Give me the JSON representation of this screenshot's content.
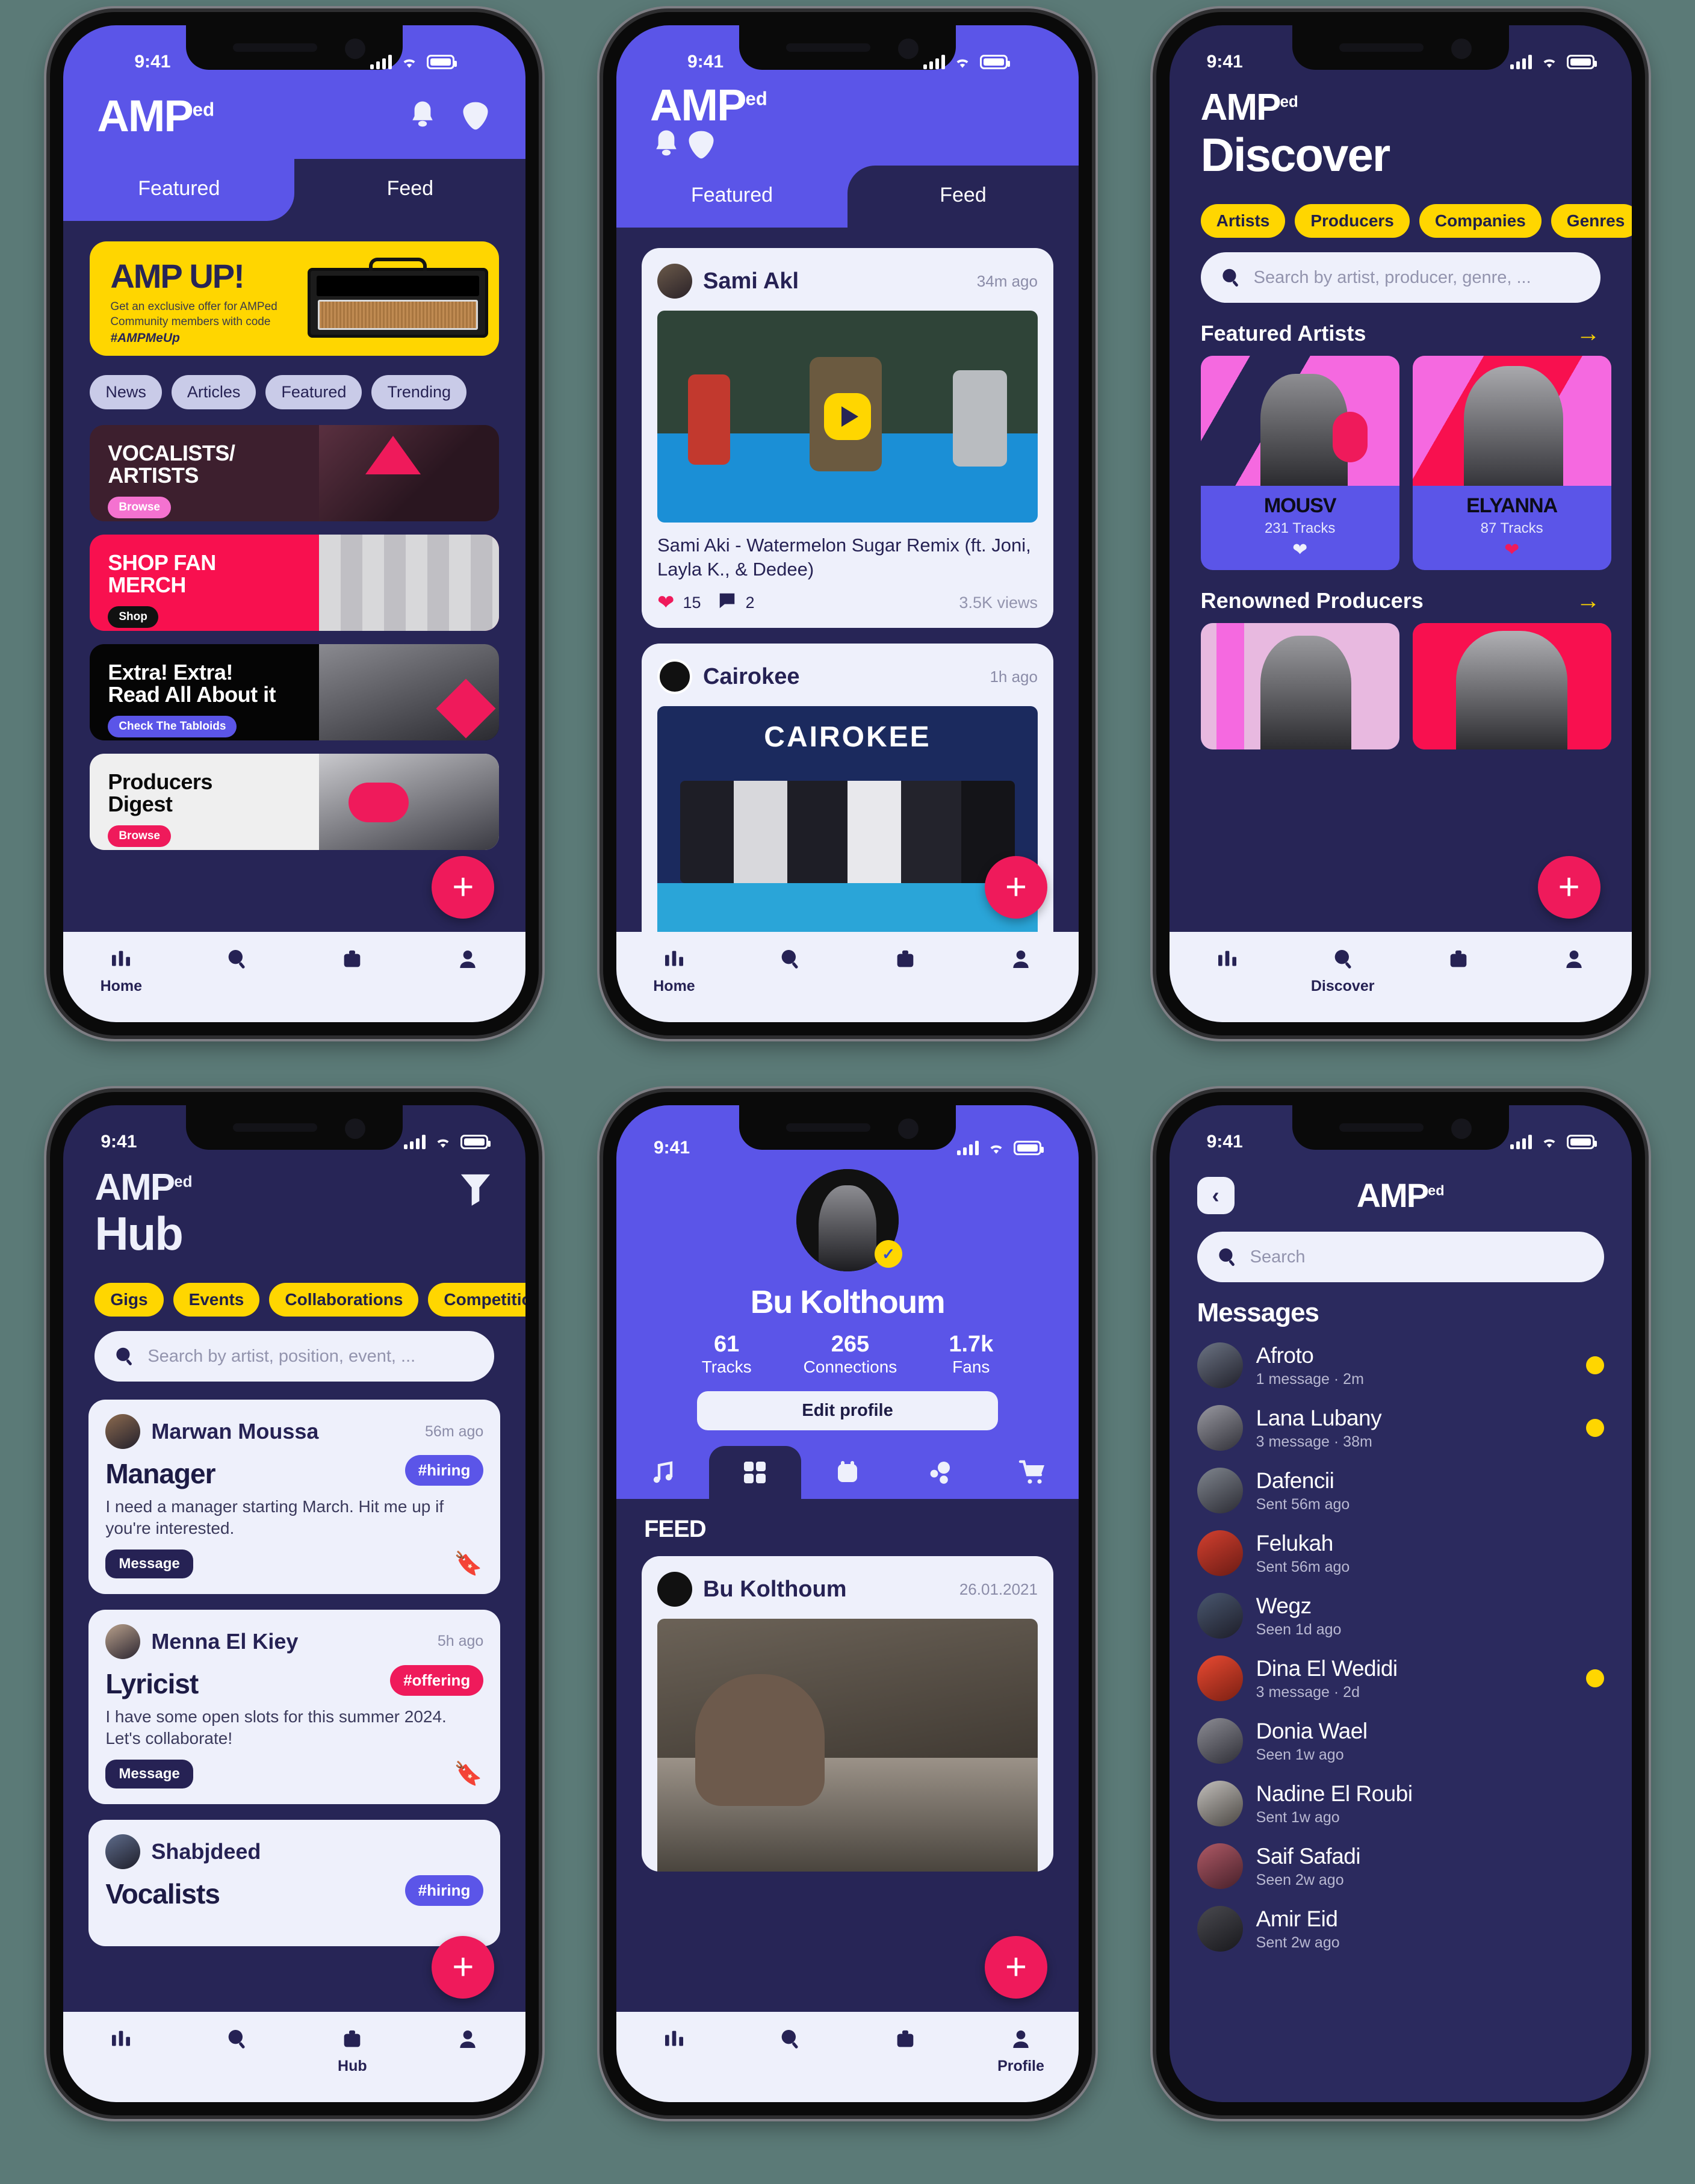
{
  "brand": {
    "name": "AMP",
    "sup": "ed",
    "accent_purple": "#5b55e8",
    "accent_yellow": "#ffd600",
    "accent_pink": "#ef1a5b",
    "dark": "#272556"
  },
  "status_bar": {
    "time": "9:41"
  },
  "screens": {
    "home": {
      "tabs": [
        {
          "label": "Featured",
          "active": true
        },
        {
          "label": "Feed",
          "active": false
        }
      ],
      "promo_banner": {
        "title": "AMP UP!",
        "body": "Get an exclusive offer for AMPed Community members with code",
        "hashtag": "#AMPMeUp"
      },
      "chips": [
        "News",
        "Articles",
        "Featured",
        "Trending"
      ],
      "cards": [
        {
          "title": "VOCALISTS/\nARTISTS",
          "button": "Browse",
          "bg": "#3d1f2e",
          "text": "#ffffff",
          "btn_bg": "#f472d0",
          "btn_text": "#ffffff"
        },
        {
          "title": "SHOP FAN\nMERCH",
          "button": "Shop",
          "bg": "#f8104f",
          "text": "#ffffff",
          "btn_bg": "#111111",
          "btn_text": "#ffffff"
        },
        {
          "title": "Extra! Extra!\nRead All About it",
          "button": "Check The Tabloids",
          "bg": "#050505",
          "text": "#ffffff",
          "btn_bg": "#5b55e8",
          "btn_text": "#ffffff"
        },
        {
          "title": "Producers\nDigest",
          "button": "Browse",
          "bg": "#efefef",
          "text": "#0a0a0a",
          "btn_bg": "#ef1a5b",
          "btn_text": "#ffffff"
        }
      ],
      "nav": [
        {
          "icon": "equalizer-icon",
          "label": "Home",
          "active": true
        },
        {
          "icon": "search-icon",
          "label": "",
          "active": false
        },
        {
          "icon": "briefcase-icon",
          "label": "",
          "active": false
        },
        {
          "icon": "person-icon",
          "label": "",
          "active": false
        }
      ]
    },
    "feed": {
      "tabs": [
        {
          "label": "Featured",
          "active": false
        },
        {
          "label": "Feed",
          "active": true
        }
      ],
      "posts": [
        {
          "author": "Sami Akl",
          "time": "34m ago",
          "title": "Sami Aki - Watermelon Sugar Remix (ft. Joni, Layla K., & Dedee)",
          "likes": "15",
          "comments": "2",
          "views": "3.5K views",
          "has_play": true
        },
        {
          "author": "Cairokee",
          "time": "1h ago",
          "title": "",
          "likes": "",
          "comments": "",
          "views": "",
          "media_label": "CAIROKEE"
        }
      ],
      "nav": [
        {
          "icon": "equalizer-icon",
          "label": "Home",
          "active": true
        },
        {
          "icon": "search-icon",
          "label": "",
          "active": false
        },
        {
          "icon": "briefcase-icon",
          "label": "",
          "active": false
        },
        {
          "icon": "person-icon",
          "label": "",
          "active": false
        }
      ]
    },
    "discover": {
      "title": "Discover",
      "chips": [
        "Artists",
        "Producers",
        "Companies",
        "Genres"
      ],
      "search_placeholder": "Search by artist, producer, genre, ...",
      "sections": [
        {
          "heading": "Featured Artists",
          "items": [
            {
              "name": "MOUSV",
              "tracks": "231 Tracks",
              "liked": false,
              "bg": "#f569e0"
            },
            {
              "name": "ELYANNA",
              "tracks": "87 Tracks",
              "liked": true,
              "bg": "#f8104f"
            }
          ]
        },
        {
          "heading": "Renowned Producers",
          "items": [
            {
              "name": "",
              "tracks": "",
              "liked": false,
              "bg": "#e8b9e0"
            },
            {
              "name": "",
              "tracks": "",
              "liked": false,
              "bg": "#f8104f"
            }
          ]
        }
      ],
      "nav": [
        {
          "icon": "equalizer-icon",
          "label": "",
          "active": false
        },
        {
          "icon": "search-icon",
          "label": "Discover",
          "active": true
        },
        {
          "icon": "briefcase-icon",
          "label": "",
          "active": false
        },
        {
          "icon": "person-icon",
          "label": "",
          "active": false
        }
      ]
    },
    "hub": {
      "title": "Hub",
      "chips": [
        "Gigs",
        "Events",
        "Collaborations",
        "Competitions"
      ],
      "search_placeholder": "Search by artist, position, event, ...",
      "listings": [
        {
          "author": "Marwan Moussa",
          "time": "56m ago",
          "role": "Manager",
          "tag": "#hiring",
          "tag_color": "#5b55e8",
          "text": "I need a manager starting March. Hit me up if you're interested.",
          "button": "Message",
          "bookmark_color": "#262254"
        },
        {
          "author": "Menna El Kiey",
          "time": "5h ago",
          "role": "Lyricist",
          "tag": "#offering",
          "tag_color": "#ef1a5b",
          "text": "I have some open slots for this summer 2024. Let's collaborate!",
          "button": "Message",
          "bookmark_color": "#ef1a5b"
        },
        {
          "author": "Shabjdeed",
          "time": "",
          "role": "Vocalists",
          "tag": "#hiring",
          "tag_color": "#5b55e8",
          "text": "",
          "button": "",
          "bookmark_color": "#262254"
        }
      ],
      "nav": [
        {
          "icon": "equalizer-icon",
          "label": "",
          "active": false
        },
        {
          "icon": "search-icon",
          "label": "",
          "active": false
        },
        {
          "icon": "briefcase-icon",
          "label": "Hub",
          "active": true
        },
        {
          "icon": "person-icon",
          "label": "",
          "active": false
        }
      ]
    },
    "profile": {
      "name": "Bu Kolthoum",
      "verified": true,
      "stats": [
        {
          "value": "61",
          "label": "Tracks"
        },
        {
          "value": "265",
          "label": "Connections"
        },
        {
          "value": "1.7k",
          "label": "Fans"
        }
      ],
      "edit_button": "Edit profile",
      "tabs": [
        {
          "icon": "music-note-icon",
          "active": false
        },
        {
          "icon": "grid-icon",
          "active": true
        },
        {
          "icon": "calendar-icon",
          "active": false
        },
        {
          "icon": "dots-cluster-icon",
          "active": false
        },
        {
          "icon": "cart-icon",
          "active": false
        }
      ],
      "feed_label": "FEED",
      "post": {
        "author": "Bu Kolthoum",
        "date": "26.01.2021"
      },
      "nav": [
        {
          "icon": "equalizer-icon",
          "label": "",
          "active": false
        },
        {
          "icon": "search-icon",
          "label": "",
          "active": false
        },
        {
          "icon": "briefcase-icon",
          "label": "",
          "active": false
        },
        {
          "icon": "person-icon",
          "label": "Profile",
          "active": true
        }
      ]
    },
    "messages": {
      "search_placeholder": "Search",
      "heading": "Messages",
      "items": [
        {
          "name": "Afroto",
          "sub": "1 message · 2m",
          "unread": true,
          "av": "#5b6272"
        },
        {
          "name": "Lana Lubany",
          "sub": "3 message · 38m",
          "unread": true,
          "av": "#8a8a92"
        },
        {
          "name": "Dafencii",
          "sub": "Sent 56m ago",
          "unread": false,
          "av": "#6a7080"
        },
        {
          "name": "Felukah",
          "sub": "Sent 56m ago",
          "unread": false,
          "av": "#c03a2b"
        },
        {
          "name": "Wegz",
          "sub": "Seen 1d ago",
          "unread": false,
          "av": "#3d4a63"
        },
        {
          "name": "Dina El Wedidi",
          "sub": "3 message · 2d",
          "unread": true,
          "av": "#e0402c"
        },
        {
          "name": "Donia Wael",
          "sub": "Seen 1w ago",
          "unread": false,
          "av": "#7e7e86"
        },
        {
          "name": "Nadine El Roubi",
          "sub": "Sent 1w ago",
          "unread": false,
          "av": "#b3b0ad"
        },
        {
          "name": "Saif Safadi",
          "sub": "Seen 2w ago",
          "unread": false,
          "av": "#a04a58"
        },
        {
          "name": "Amir Eid",
          "sub": "Sent 2w ago",
          "unread": false,
          "av": "#3a3a3c"
        }
      ]
    }
  }
}
